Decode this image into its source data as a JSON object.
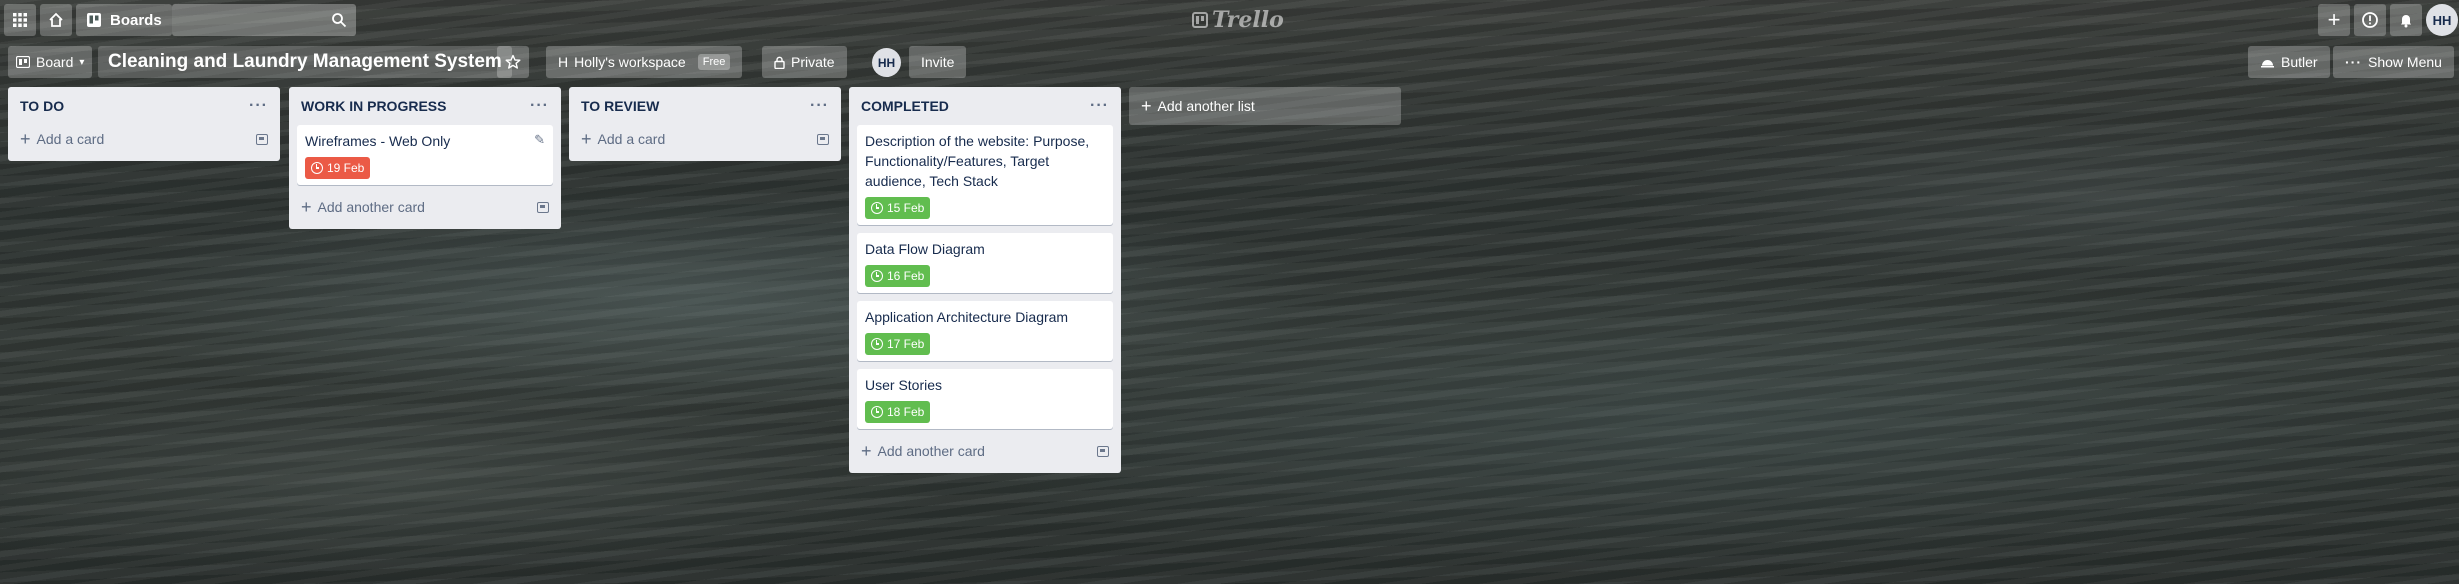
{
  "topbar": {
    "apps_icon": "grid-icon",
    "home_icon": "home-icon",
    "boards_label": "Boards",
    "search_icon": "search-icon",
    "logo_text": "Trello",
    "create_icon": "plus-icon",
    "info_icon": "info-icon",
    "notifications_icon": "bell-icon",
    "user_initials": "HH"
  },
  "boardbar": {
    "view_label": "Board",
    "title": "Cleaning and Laundry Management System",
    "workspace_initial": "H",
    "workspace_label": "Holly's workspace",
    "workspace_badge": "Free",
    "visibility_label": "Private",
    "member_initials": "HH",
    "invite_label": "Invite",
    "butler_label": "Butler",
    "show_menu_label": "Show Menu"
  },
  "lists": [
    {
      "title": "TO DO",
      "menu": "···",
      "cards": [],
      "add_label": "Add a card"
    },
    {
      "title": "WORK IN PROGRESS",
      "menu": "···",
      "cards": [
        {
          "title": "Wireframes - Web Only",
          "due": "19 Feb",
          "status": "overdue"
        }
      ],
      "add_label": "Add another card"
    },
    {
      "title": "TO REVIEW",
      "menu": "···",
      "cards": [],
      "add_label": "Add a card"
    },
    {
      "title": "COMPLETED",
      "menu": "···",
      "cards": [
        {
          "title": "Description of the website: Purpose, Functionality/Features, Target audience, Tech Stack",
          "due": "15 Feb",
          "status": "complete"
        },
        {
          "title": "Data Flow Diagram",
          "due": "16 Feb",
          "status": "complete"
        },
        {
          "title": "Application Architecture Diagram",
          "due": "17 Feb",
          "status": "complete"
        },
        {
          "title": "User Stories",
          "due": "18 Feb",
          "status": "complete"
        }
      ],
      "add_label": "Add another card"
    }
  ],
  "add_list_label": "Add another list",
  "colors": {
    "due_complete": "#61bd4f",
    "due_overdue": "#eb5a46",
    "list_bg": "#ebecf0"
  }
}
